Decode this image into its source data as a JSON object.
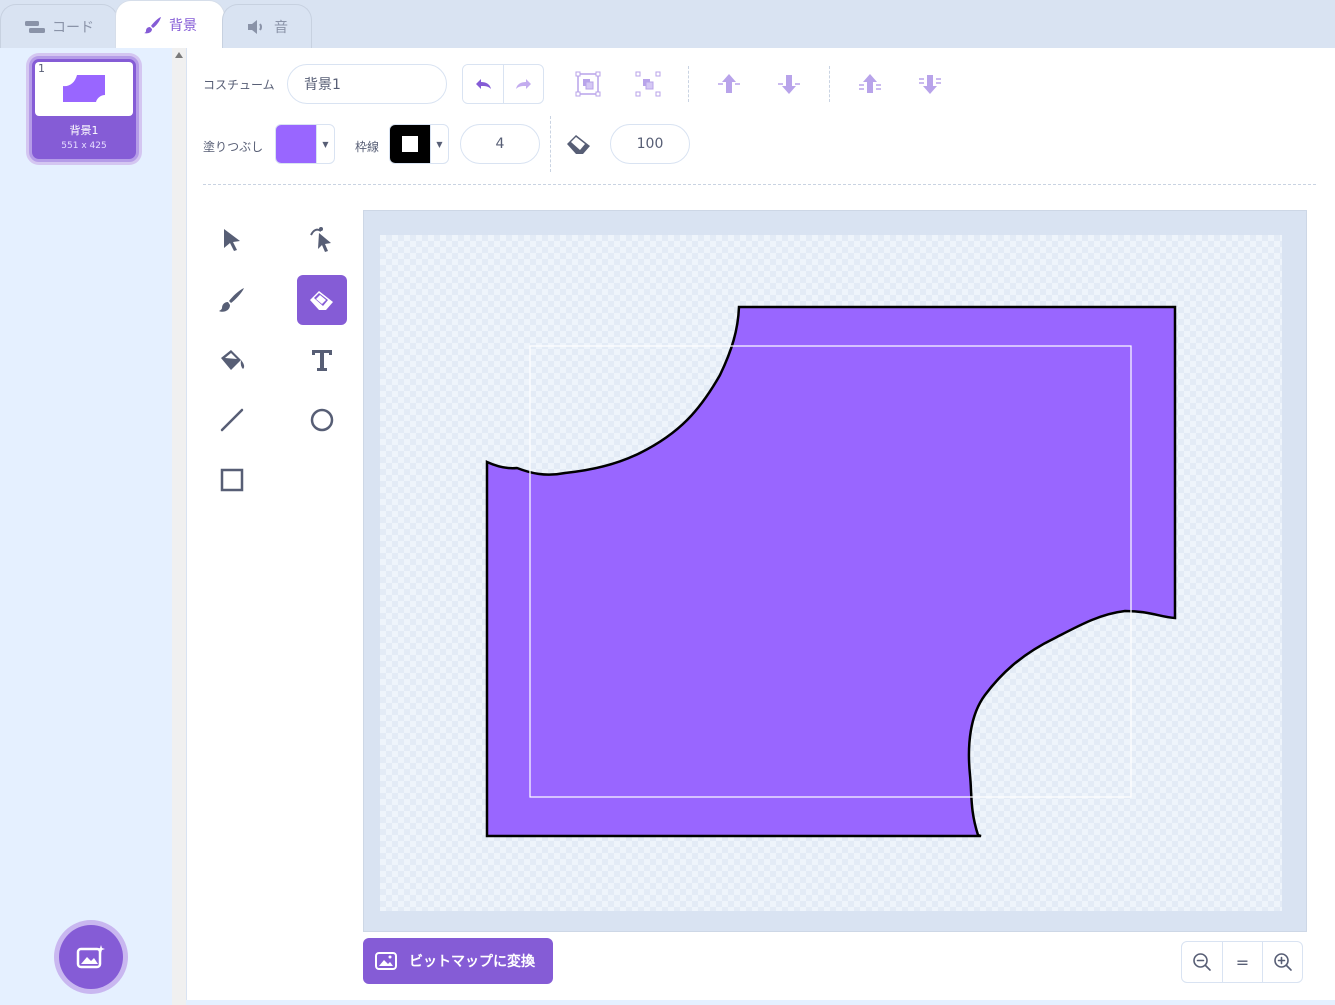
{
  "tabs": [
    {
      "label": "コード",
      "icon": "code-blocks-icon"
    },
    {
      "label": "背景",
      "icon": "paintbrush-icon",
      "active": true
    },
    {
      "label": "音",
      "icon": "speaker-icon"
    }
  ],
  "costumes": [
    {
      "number": "1",
      "name": "背景1",
      "size": "551 x 425",
      "selected": true
    }
  ],
  "toolbar": {
    "costume_label": "コスチューム",
    "costume_name": "背景1",
    "fill_label": "塗りつぶし",
    "fill_color": "#9966ff",
    "outline_label": "枠線",
    "outline_color": "#000000",
    "outline_width": "4",
    "eraser_size": "100"
  },
  "tools": {
    "active": "eraser"
  },
  "convert_button_label": "ビットマップに変換",
  "zoom": {
    "reset_label": "="
  },
  "colors": {
    "accent": "#855cd6",
    "shape_fill": "#9966ff",
    "text": "#575e75"
  }
}
